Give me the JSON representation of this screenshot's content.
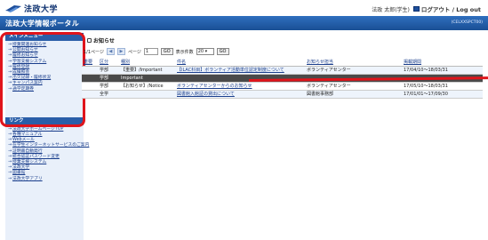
{
  "header": {
    "logo_text": "法政大学",
    "user_name": "法政 太郎(学生)",
    "logout_label": "ログアウト / Log out"
  },
  "titlebar": {
    "title": "法政大学情報ポータル",
    "code": "(CELXXSPCT00)"
  },
  "menu": {
    "header": "メインメニュー",
    "items": [
      "授業関連お知らせ",
      "公開お知らせ",
      "履修お知らせ",
      "学習支援システム",
      "履修登録",
      "成績照会",
      "出欠記録・履修状況",
      "キャンパス案内",
      "通学定期券"
    ]
  },
  "links": {
    "header": "リンク",
    "items": [
      "法政大学ホームページTOP",
      "各種マニュアル",
      "Webメール",
      "在学生インターネットサービスのご案内",
      "証明書自動発行",
      "統合認証パスワード変更",
      "授業支援システム",
      "法政大学",
      "図書館",
      "法政大学アプリ"
    ]
  },
  "notices": {
    "title": "お知らせ",
    "pager": {
      "prefix": "1/1ページ",
      "page_label": "ページ",
      "page_value": "1",
      "go": "GO",
      "per_page_label": "表示件数",
      "per_page_value": "20",
      "go2": "GO"
    },
    "columns": [
      "重要",
      "区分",
      "種別",
      "件名",
      "お知らせ担当",
      "掲載期間"
    ],
    "rows": [
      {
        "imp": "",
        "kubun": "学部",
        "type": "【重要】/Important",
        "subject": "【ILAC科目】ボランティア活動単位認定制度について",
        "owner": "ボランティアセンター",
        "period": "17/04/10〜18/03/31"
      },
      {
        "imp": "",
        "kubun": "学部",
        "type": "Important",
        "subject": "",
        "owner": "",
        "period": ""
      },
      {
        "imp": "",
        "kubun": "学部",
        "type": "【お知らせ】/Notice",
        "subject": "ボランティアセンターからのお知らせ",
        "owner": "ボランティアセンター",
        "period": "17/05/10〜18/03/31"
      },
      {
        "imp": "",
        "kubun": "全学",
        "type": "",
        "subject": "図書館入館証の貸出について",
        "owner": "図書館事務部",
        "period": "17/01/01〜17/09/30"
      }
    ]
  },
  "colors": {
    "brand_blue": "#1a4f95",
    "annotation_red": "#e0141b"
  }
}
